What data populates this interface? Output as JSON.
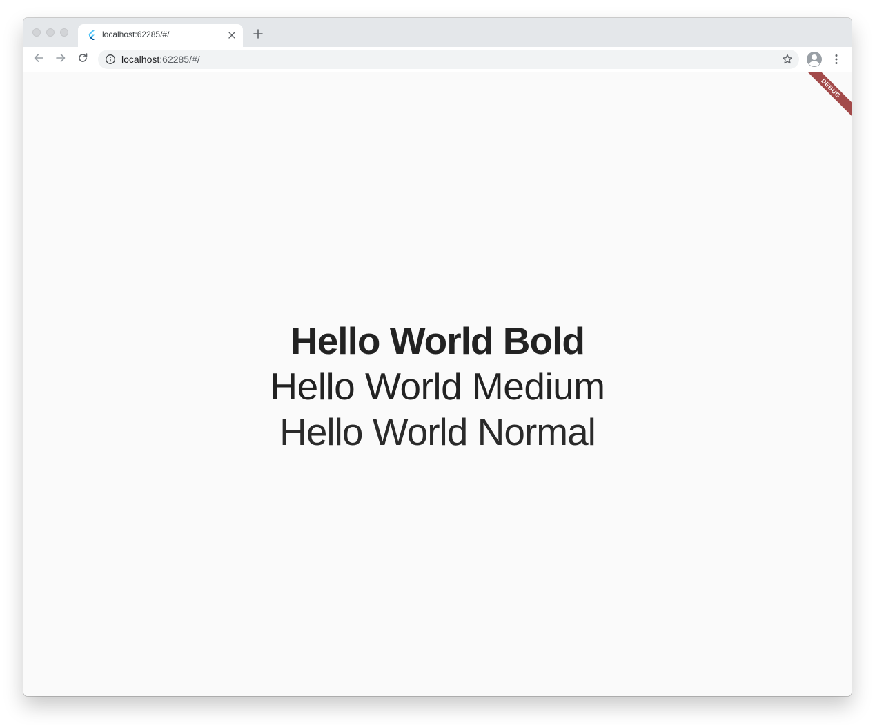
{
  "browser": {
    "tab": {
      "title": "localhost:62285/#/",
      "favicon": "flutter-logo-icon"
    },
    "toolbar": {
      "url_host": "localhost",
      "url_rest": ":62285/#/"
    },
    "colors": {
      "tabstrip": "#e4e7ea",
      "page_background": "#fafafa",
      "text": "#222222",
      "debug_banner": "#a34a4a"
    }
  },
  "app": {
    "debug_banner": "DEBUG",
    "lines": {
      "bold": "Hello World Bold",
      "medium": "Hello World Medium",
      "normal": "Hello World Normal"
    }
  }
}
